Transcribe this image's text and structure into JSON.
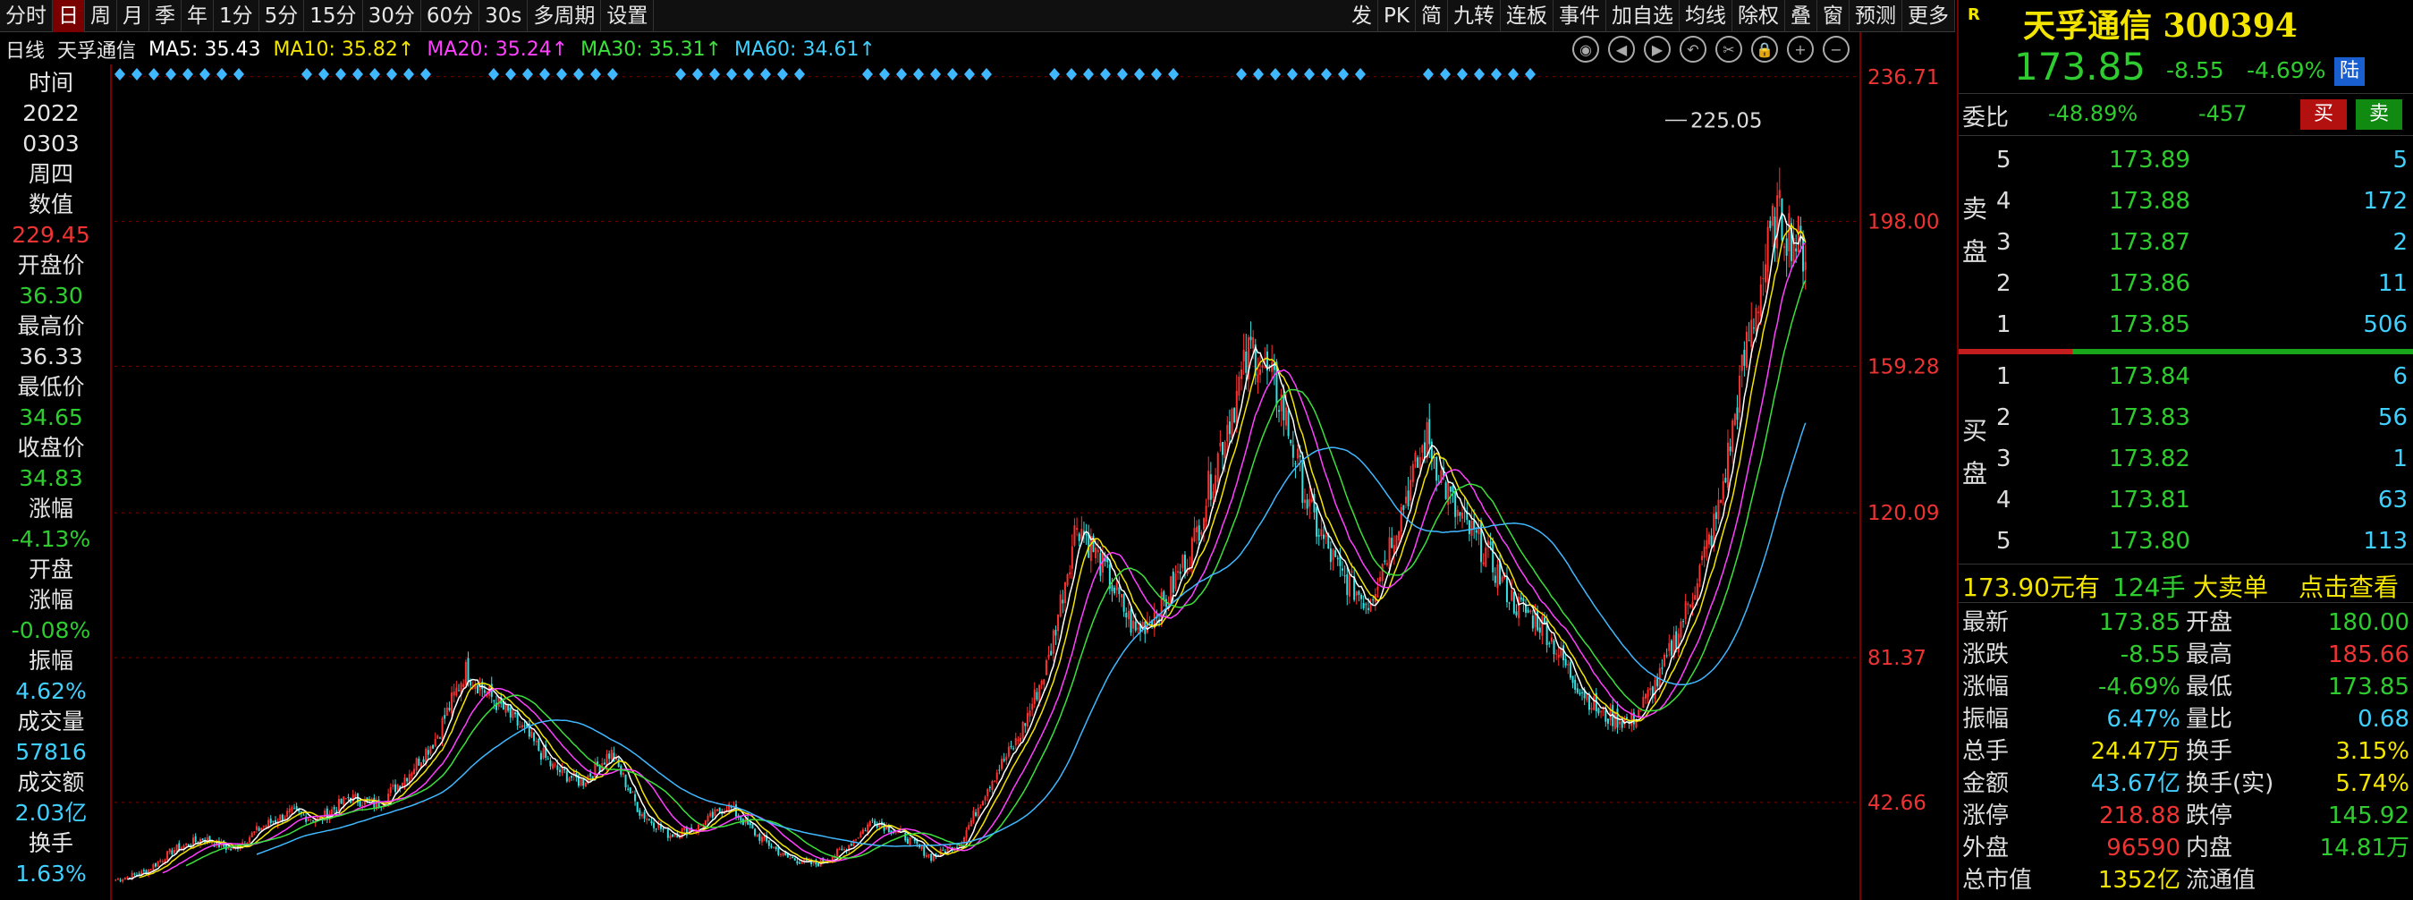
{
  "toolbar": {
    "items": [
      "分时",
      "日",
      "周",
      "月",
      "季",
      "年",
      "1分",
      "5分",
      "15分",
      "30分",
      "60分",
      "30s",
      "多周期",
      "设置"
    ],
    "right_items": [
      "发",
      "PK",
      "简",
      "九转",
      "连板",
      "事件",
      "加自选",
      "均线",
      "除权",
      "叠",
      "窗",
      "预测",
      "更多"
    ]
  },
  "ma": {
    "period": "日线",
    "name": "天孚通信",
    "ma5": "MA5: 35.43",
    "ma10": "MA10: 35.82↑",
    "ma20": "MA20: 35.24↑",
    "ma30": "MA30: 35.31↑",
    "ma60": "MA60: 34.61↑"
  },
  "info": {
    "time_label": "时间",
    "date_year": "2022",
    "date_md": "0303",
    "weekday": "周四",
    "value_label": "数值",
    "value": "229.45",
    "open_label": "开盘价",
    "open": "36.30",
    "high_label": "最高价",
    "high": "36.33",
    "low_label": "最低价",
    "low": "34.65",
    "close_label": "收盘价",
    "close": "34.83",
    "chg_label": "涨幅",
    "chg": "-4.13%",
    "open_chg_label1": "开盘",
    "open_chg_label2": "涨幅",
    "open_chg": "-0.08%",
    "amp_label": "振幅",
    "amp": "4.62%",
    "vol_label": "成交量",
    "vol": "57816",
    "amt_label": "成交额",
    "amt": "2.03亿",
    "turn_label": "换手",
    "turn": "1.63%"
  },
  "chart_data": {
    "type": "candlestick",
    "y_ticks": [
      "236.71",
      "198.00",
      "159.28",
      "120.09",
      "81.37",
      "42.66"
    ],
    "y_values": [
      236.71,
      198.0,
      159.28,
      120.09,
      81.37,
      42.66
    ],
    "ylim": [
      18,
      240
    ],
    "peak_label": "225.05",
    "peak_value": 225.05,
    "trend": [
      22,
      24,
      30,
      33,
      30,
      36,
      40,
      38,
      44,
      42,
      50,
      60,
      78,
      70,
      62,
      52,
      48,
      56,
      40,
      34,
      36,
      42,
      34,
      28,
      26,
      30,
      38,
      34,
      28,
      32,
      48,
      60,
      80,
      118,
      104,
      88,
      96,
      112,
      140,
      165,
      150,
      120,
      104,
      96,
      118,
      140,
      120,
      110,
      96,
      90,
      76,
      66,
      64,
      76,
      96,
      120,
      165,
      200,
      190
    ],
    "colors": {
      "up": "#ff3030",
      "down": "#35e0e0",
      "ma5": "#ffffff",
      "ma10": "#f3e500",
      "ma20": "#ff40ff",
      "ma30": "#3ce03c",
      "ma60": "#40b8ff"
    }
  },
  "quote": {
    "title": "天孚通信 300394",
    "price": "173.85",
    "change": "-8.55",
    "pct": "-4.69%",
    "market": "陆",
    "wb_label": "委比",
    "wb": "-48.89%",
    "wc": "-457",
    "buy": "买",
    "sell": "卖",
    "sell_label": "卖盘",
    "buy_label": "买盘",
    "asks": [
      [
        "5",
        "173.89",
        "5"
      ],
      [
        "4",
        "173.88",
        "172"
      ],
      [
        "3",
        "173.87",
        "2"
      ],
      [
        "2",
        "173.86",
        "11"
      ],
      [
        "1",
        "173.85",
        "506"
      ]
    ],
    "bids": [
      [
        "1",
        "173.84",
        "6"
      ],
      [
        "2",
        "173.83",
        "56"
      ],
      [
        "3",
        "173.82",
        "1"
      ],
      [
        "4",
        "173.81",
        "63"
      ],
      [
        "5",
        "173.80",
        "113"
      ]
    ],
    "big_price": "173.90元有",
    "big_hand": "124手",
    "big_type": "大卖单",
    "big_link": "点击查看",
    "stats": [
      [
        "最新",
        "173.85",
        "g",
        "开盘",
        "180.00",
        "g"
      ],
      [
        "涨跌",
        "-8.55",
        "g",
        "最高",
        "185.66",
        "r"
      ],
      [
        "涨幅",
        "-4.69%",
        "g",
        "最低",
        "173.85",
        "g"
      ],
      [
        "振幅",
        "6.47%",
        "c",
        "量比",
        "0.68",
        "c"
      ],
      [
        "总手",
        "24.47万",
        "y",
        "换手",
        "3.15%",
        "y"
      ],
      [
        "金额",
        "43.67亿",
        "c",
        "换手(实)",
        "5.74%",
        "y"
      ],
      [
        "涨停",
        "218.88",
        "r",
        "跌停",
        "145.92",
        "g"
      ],
      [
        "外盘",
        "96590",
        "r",
        "内盘",
        "14.81万",
        "g"
      ],
      [
        "总市值",
        "1352亿",
        "y",
        "流通值",
        "",
        ""
      ]
    ]
  }
}
